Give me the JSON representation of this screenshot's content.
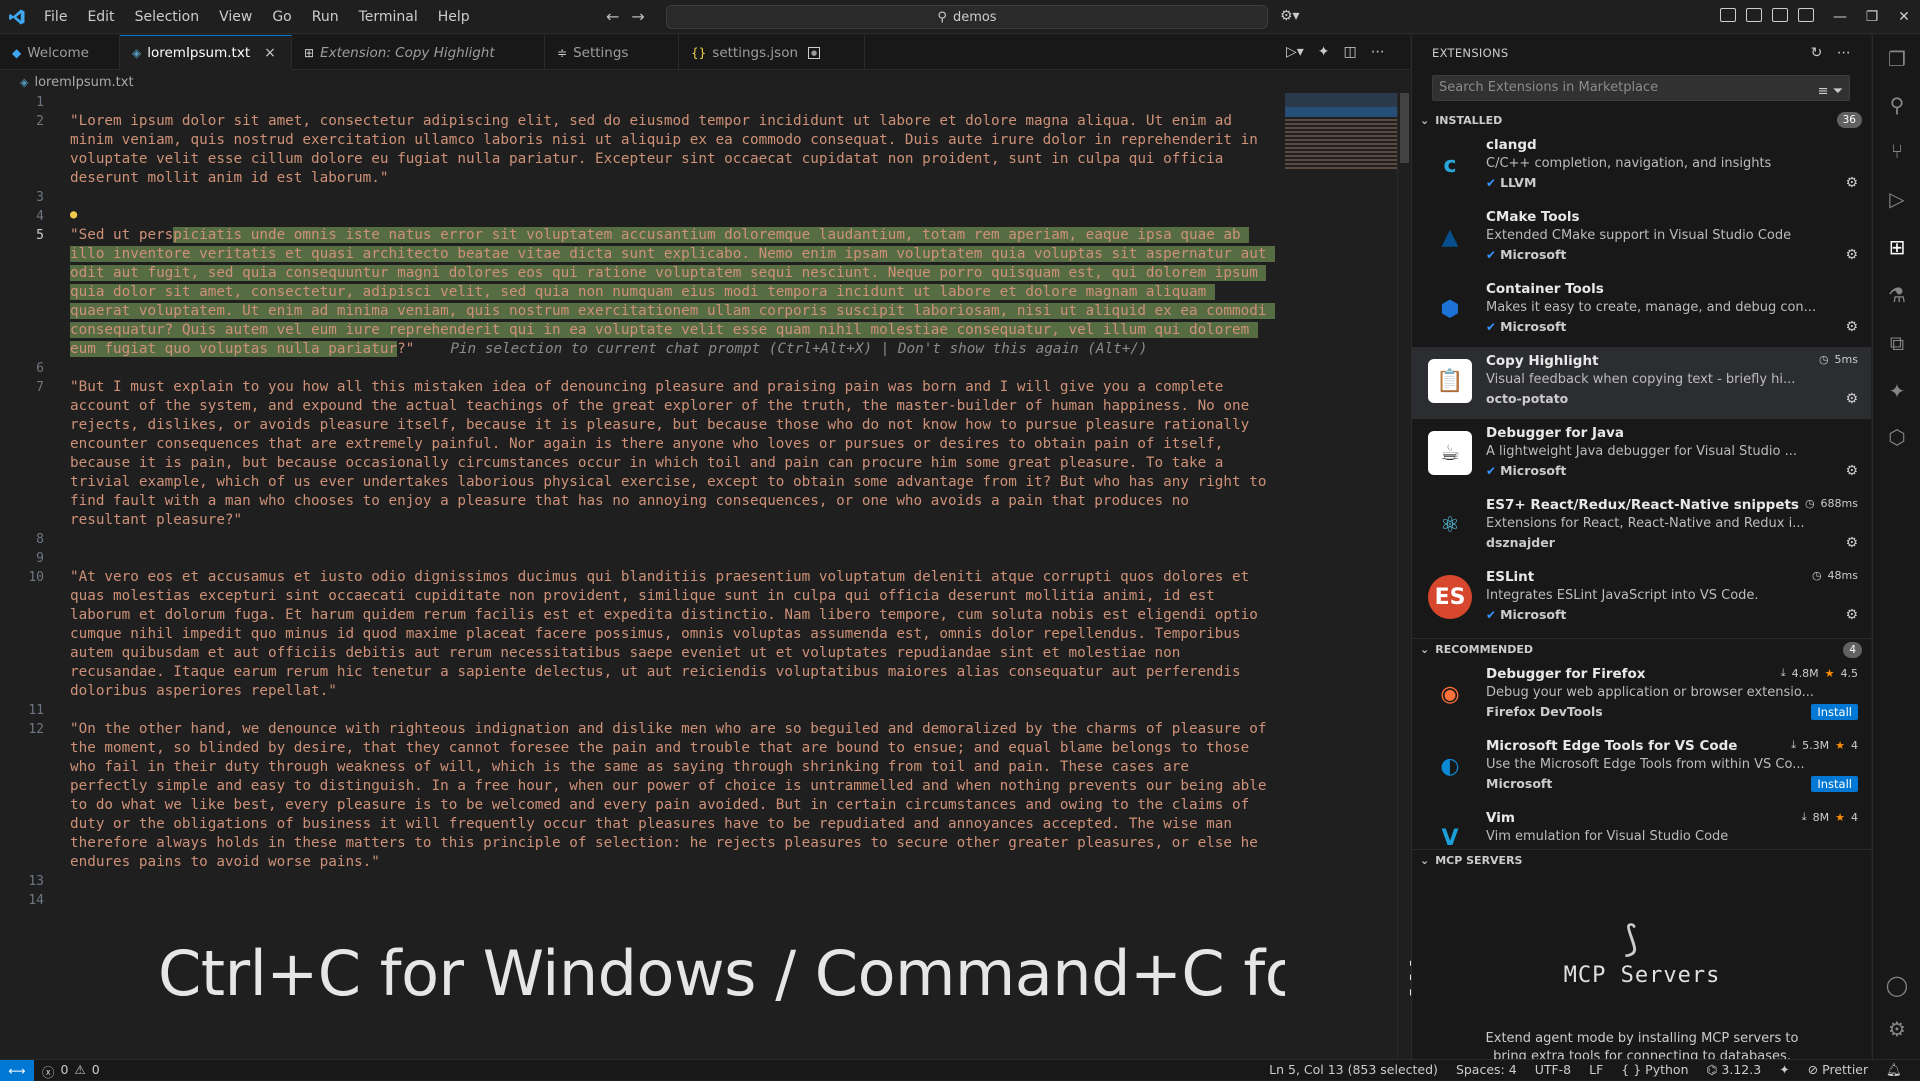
{
  "titlebar": {
    "menu": [
      "File",
      "Edit",
      "Selection",
      "View",
      "Go",
      "Run",
      "Terminal",
      "Help"
    ],
    "command_center": "demos"
  },
  "tabs": [
    {
      "label": "Welcome",
      "icon": "vscode-icon"
    },
    {
      "label": "loremIpsum.txt",
      "icon": "text-file-icon",
      "close": "×"
    },
    {
      "label": "Extension: Copy Highlight",
      "icon": "extension-icon"
    },
    {
      "label": "Settings",
      "icon": "settings-icon"
    },
    {
      "label": "settings.json",
      "icon": "json-icon",
      "braces": "{}"
    }
  ],
  "breadcrumb": {
    "file": "loremIpsum.txt"
  },
  "editor": {
    "line_numbers": [
      "1",
      "2",
      "3",
      "4",
      "5",
      "6",
      "7",
      "8",
      "9",
      "10",
      "11",
      "12",
      "13",
      "14"
    ],
    "para2": "\"Lorem ipsum dolor sit amet, consectetur adipiscing elit, sed do eiusmod tempor incididunt ut labore et dolore magna aliqua. Ut enim ad minim veniam, quis nostrud exercitation ullamco laboris nisi ut aliquip ex ea commodo consequat. Duis aute irure dolor in reprehenderit in voluptate velit esse cillum dolore eu fugiat nulla pariatur. Excepteur sint occaecat cupidatat non proident, sunt in culpa qui officia deserunt mollit anim id est laborum.\"",
    "para5_pre": "\"Sed ut pers",
    "para5_sel": "piciatis unde omnis iste natus error sit voluptatem accusantium doloremque laudantium, totam rem aperiam, eaque ipsa quae ab illo inventore veritatis et quasi architecto beatae vitae dicta sunt explicabo. Nemo enim ipsam voluptatem quia voluptas sit aspernatur aut odit aut fugit, sed quia consequuntur magni dolores eos qui ratione voluptatem sequi nesciunt. Neque porro quisquam est, qui dolorem ipsum quia dolor sit amet, consectetur, adipisci velit, sed quia non numquam eius modi tempora incidunt ut labore et dolore magnam aliquam quaerat voluptatem. Ut enim ad minima veniam, quis nostrum exercitationem ullam corporis suscipit laboriosam, nisi ut aliquid ex ea commodi consequatur? Quis autem vel eum iure reprehenderit qui in ea voluptate velit esse quam nihil molestiae consequatur, vel illum qui dolorem eum fugiat quo voluptas nulla pariatur",
    "para5_post": "?\"",
    "para5_hint": "Pin selection to current chat prompt (Ctrl+Alt+X) | Don't show this again (Alt+/)",
    "para7": "\"But I must explain to you how all this mistaken idea of denouncing pleasure and praising pain was born and I will give you a complete account of the system, and expound the actual teachings of the great explorer of the truth, the master-builder of human happiness. No one rejects, dislikes, or avoids pleasure itself, because it is pleasure, but because those who do not know how to pursue pleasure rationally encounter consequences that are extremely painful. Nor again is there anyone who loves or pursues or desires to obtain pain of itself, because it is pain, but because occasionally circumstances occur in which toil and pain can procure him some great pleasure. To take a trivial example, which of us ever undertakes laborious physical exercise, except to obtain some advantage from it? But who has any right to find fault with a man who chooses to enjoy a pleasure that has no annoying consequences, or one who avoids a pain that produces no resultant pleasure?\"",
    "para10": "\"At vero eos et accusamus et iusto odio dignissimos ducimus qui blanditiis praesentium voluptatum deleniti atque corrupti quos dolores et quas molestias excepturi sint occaecati cupiditate non provident, similique sunt in culpa qui officia deserunt mollitia animi, id est laborum et dolorum fuga. Et harum quidem rerum facilis est et expedita distinctio. Nam libero tempore, cum soluta nobis est eligendi optio cumque nihil impedit quo minus id quod maxime placeat facere possimus, omnis voluptas assumenda est, omnis dolor repellendus. Temporibus autem quibusdam et aut officiis debitis aut rerum necessitatibus saepe eveniet ut et voluptates repudiandae sint et molestiae non recusandae. Itaque earum rerum hic tenetur a sapiente delectus, ut aut reiciendis voluptatibus maiores alias consequatur aut perferendis doloribus asperiores repellat.\"",
    "para12": "\"On the other hand, we denounce with righteous indignation and dislike men who are so beguiled and demoralized by the charms of pleasure of the moment, so blinded by desire, that they cannot foresee the pain and trouble that are bound to ensue; and equal blame belongs to those who fail in their duty through weakness of will, which is the same as saying through shrinking from toil and pain. These cases are perfectly simple and easy to distinguish. In a free hour, when our power of choice is untrammelled and when nothing prevents our being able to do what we like best, every pleasure is to be welcomed and every pain avoided. But in certain circumstances and owing to the claims of duty or the obligations of business it will frequently occur that pleasures have to be repudiated and annoyances accepted. The wise man therefore always holds in these matters to this principle of selection: he rejects pleasures to secure other greater pleasures, or else he endures pains to avoid worse pains.\"",
    "overlay_caption": "Ctrl+C for Windows / Command+C for Mac"
  },
  "sidebar": {
    "title": "EXTENSIONS",
    "search_placeholder": "Search Extensions in Marketplace",
    "installed": {
      "label": "INSTALLED",
      "count": "36"
    },
    "installed_items": [
      {
        "name": "clangd",
        "desc": "C/C++ completion, navigation, and insights",
        "publisher": "LLVM",
        "verified": true,
        "icon": "clangd-icon",
        "color": "#2aa5d8"
      },
      {
        "name": "CMake Tools",
        "desc": "Extended CMake support in Visual Studio Code",
        "publisher": "Microsoft",
        "verified": true,
        "icon": "cmake-icon",
        "color": "#064f8c"
      },
      {
        "name": "Container Tools",
        "desc": "Makes it easy to create, manage, and debug con...",
        "publisher": "Microsoft",
        "verified": true,
        "icon": "container-icon",
        "color": "#1d72d8"
      },
      {
        "name": "Copy Highlight",
        "desc": "Visual feedback when copying text - briefly hi...",
        "publisher": "octo-potato",
        "verified": false,
        "meta": "5ms",
        "icon": "clipboard-icon",
        "color": "#ffffff"
      },
      {
        "name": "Debugger for Java",
        "desc": "A lightweight Java debugger for Visual Studio ...",
        "publisher": "Microsoft",
        "verified": true,
        "icon": "java-icon",
        "color": "#ffffff"
      },
      {
        "name": "ES7+ React/Redux/React-Native snippets",
        "desc": "Extensions for React, React-Native and Redux i...",
        "publisher": "dsznajder",
        "verified": false,
        "meta": "688ms",
        "icon": "react-icon",
        "color": "#61dafb"
      },
      {
        "name": "ESLint",
        "desc": "Integrates ESLint JavaScript into VS Code.",
        "publisher": "Microsoft",
        "verified": true,
        "meta": "48ms",
        "icon": "eslint-icon",
        "color": "#d7472d"
      }
    ],
    "recommended": {
      "label": "RECOMMENDED",
      "count": "4"
    },
    "recommended_items": [
      {
        "name": "Debugger for Firefox",
        "desc": "Debug your web application or browser extensio...",
        "publisher": "Firefox DevTools",
        "downloads": "4.8M",
        "rating": "4.5",
        "action": "Install",
        "icon": "firefox-icon",
        "color": "#ff7139"
      },
      {
        "name": "Microsoft Edge Tools for VS Code",
        "desc": "Use the Microsoft Edge Tools from within VS Co...",
        "publisher": "Microsoft",
        "downloads": "5.3M",
        "rating": "4",
        "action": "Install",
        "icon": "edge-icon",
        "color": "#0c8ad6"
      },
      {
        "name": "Vim",
        "desc": "Vim emulation for Visual Studio Code",
        "publisher": "",
        "downloads": "8M",
        "rating": "4",
        "action": "",
        "icon": "vim-icon",
        "color": "#1b9fd8"
      }
    ],
    "mcp": {
      "label": "MCP SERVERS",
      "title": "MCP Servers",
      "desc": "Extend agent mode by installing MCP servers to bring extra tools for connecting to databases, invoking APIs and"
    }
  },
  "statusbar": {
    "errors": "0",
    "warnings": "0",
    "position": "Ln 5, Col 13 (853 selected)",
    "spaces": "Spaces: 4",
    "encoding": "UTF-8",
    "eol": "LF",
    "language": "Python",
    "python_version": "3.12.3",
    "formatter": "Prettier"
  },
  "colors": {
    "accent": "#0078d4",
    "string": "#ce9178",
    "selection": "#799d5a"
  }
}
